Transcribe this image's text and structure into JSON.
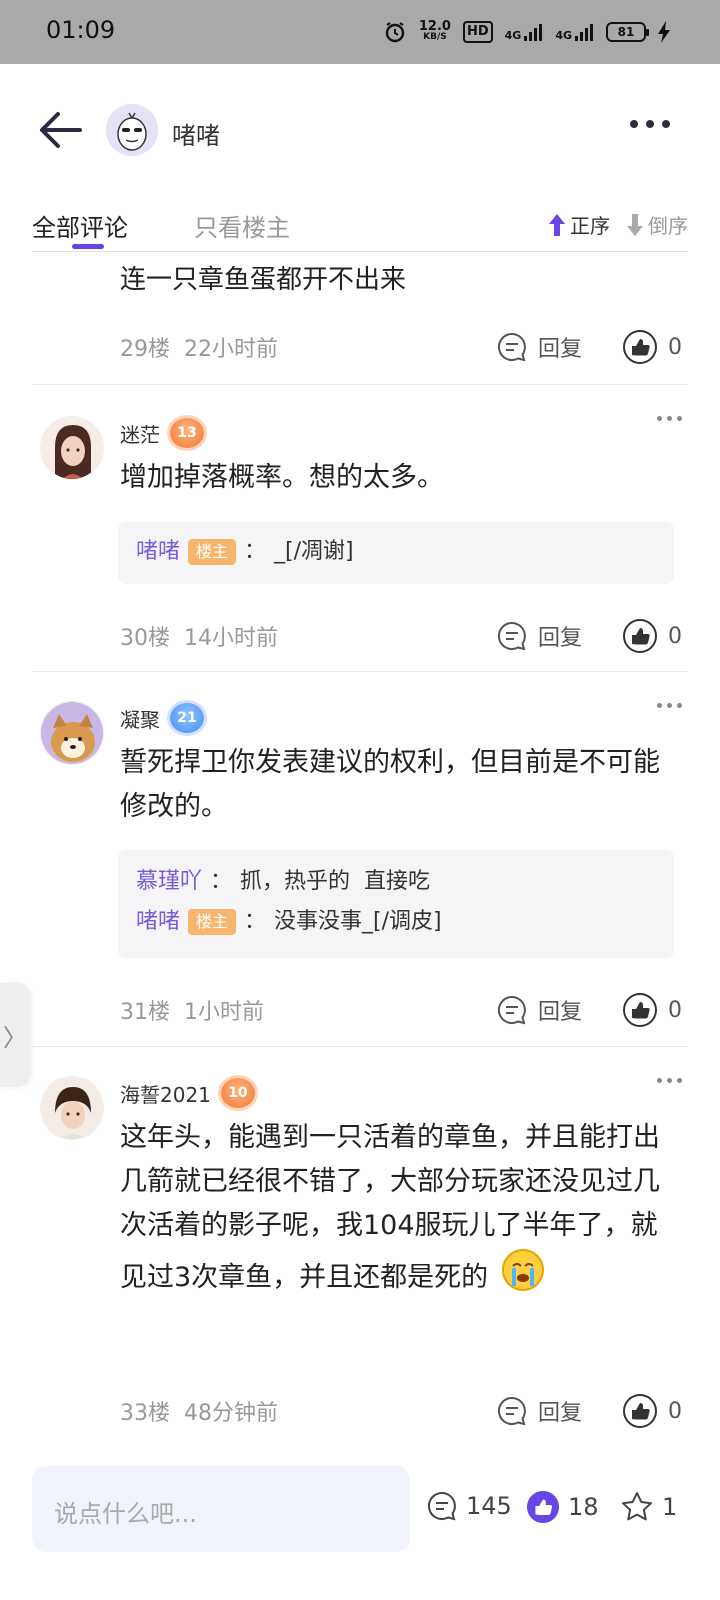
{
  "status_bar": {
    "time": "01:09",
    "speed_value": "12.0",
    "speed_unit": "KB/S",
    "hd": "HD",
    "net1": "4G",
    "net2": "4G",
    "battery": "81"
  },
  "header": {
    "title": "啫啫"
  },
  "tabs": {
    "all": "全部评论",
    "owner_only": "只看楼主",
    "sort_asc": "正序",
    "sort_desc": "倒序"
  },
  "partial": {
    "text": "连一只章鱼蛋都开不出来",
    "floor": "29楼",
    "time": "22小时前",
    "reply": "回复",
    "likes": "0"
  },
  "comments": [
    {
      "name": "迷茫",
      "level": "13",
      "text": "增加掉落概率。想的太多。",
      "subs": [
        {
          "name": "啫啫",
          "tag": "楼主",
          "sep": "：",
          "text": "_[/凋谢]"
        }
      ],
      "floor": "30楼",
      "time": "14小时前",
      "reply": "回复",
      "likes": "0"
    },
    {
      "name": "凝聚",
      "level": "21",
      "text": "誓死捍卫你发表建议的权利，但目前是不可能修改的。",
      "subs": [
        {
          "name": "慕瑾吖",
          "sep": "：",
          "text": "抓，热乎的  直接吃"
        },
        {
          "name": "啫啫",
          "tag": "楼主",
          "sep": "：",
          "text": "没事没事_[/调皮]"
        }
      ],
      "floor": "31楼",
      "time": "1小时前",
      "reply": "回复",
      "likes": "0"
    },
    {
      "name": "海誓2021",
      "level": "10",
      "text": "这年头，能遇到一只活着的章鱼，并且能打出几箭就已经很不错了，大部分玩家还没见过几次活着的影子呢，我104服玩儿了半年了，就见过3次章鱼，并且还都是死的",
      "floor": "33楼",
      "time": "48分钟前",
      "reply": "回复",
      "likes": "0"
    }
  ],
  "bottom": {
    "placeholder": "说点什么吧...",
    "comments": "145",
    "likes": "18",
    "favorites": "1"
  },
  "colors": {
    "accent": "#6a45e6",
    "name_purple": "#7a5ad6",
    "owner_tag": "#f7b66e"
  }
}
